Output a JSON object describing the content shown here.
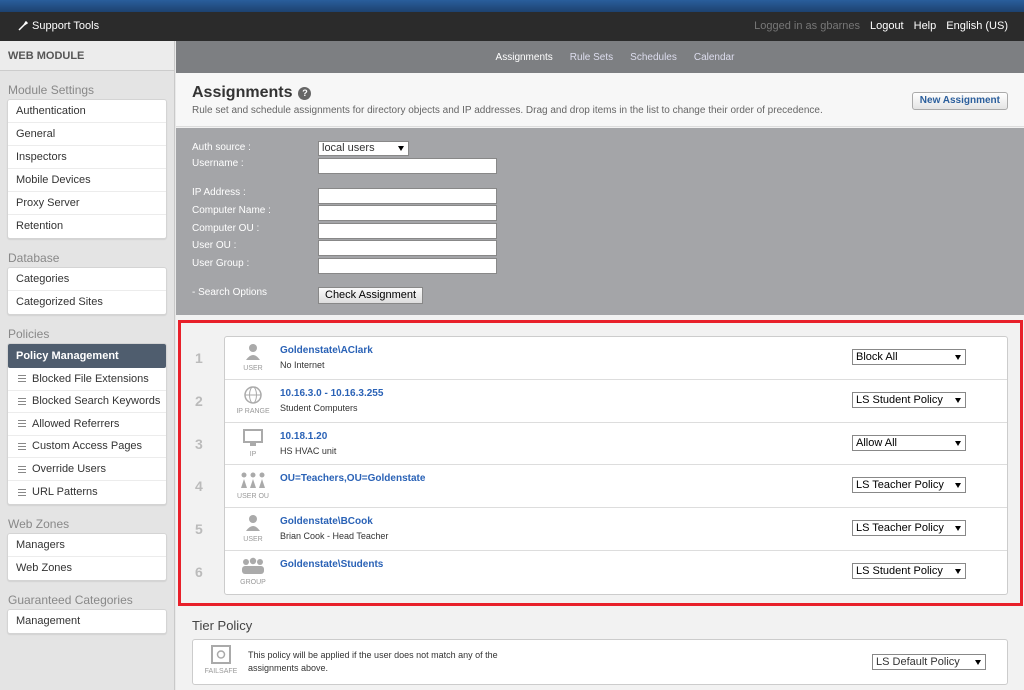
{
  "topbar": {
    "brand": "Support Tools",
    "logged_in": "Logged in as gbarnes",
    "logout": "Logout",
    "help": "Help",
    "language": "English (US)"
  },
  "sidebar": {
    "title": "WEB MODULE",
    "module_settings": {
      "heading": "Module Settings",
      "items": [
        "Authentication",
        "General",
        "Inspectors",
        "Mobile Devices",
        "Proxy Server",
        "Retention"
      ]
    },
    "database": {
      "heading": "Database",
      "items": [
        "Categories",
        "Categorized Sites"
      ]
    },
    "policies": {
      "heading": "Policies",
      "active": "Policy Management",
      "items": [
        "Blocked File Extensions",
        "Blocked Search Keywords",
        "Allowed Referrers",
        "Custom Access Pages",
        "Override Users",
        "URL Patterns"
      ]
    },
    "web_zones": {
      "heading": "Web Zones",
      "items": [
        "Managers",
        "Web Zones"
      ]
    },
    "guaranteed": {
      "heading": "Guaranteed Categories",
      "items": [
        "Management"
      ]
    }
  },
  "tabs": [
    "Assignments",
    "Rule Sets",
    "Schedules",
    "Calendar"
  ],
  "header": {
    "title": "Assignments",
    "help_icon": "?",
    "description": "Rule set and schedule assignments for directory objects and IP addresses. Drag and drop items in the list to change their order of precedence.",
    "new_button": "New Assignment"
  },
  "search": {
    "auth_source_label": "Auth source :",
    "auth_source_value": "local users",
    "username_label": "Username :",
    "ip_label": "IP Address :",
    "computer_name_label": "Computer Name :",
    "computer_ou_label": "Computer OU :",
    "user_ou_label": "User OU :",
    "user_group_label": "User Group :",
    "options_label": "- Search Options",
    "check_button": "Check Assignment"
  },
  "assignments": [
    {
      "num": "1",
      "type": "USER",
      "name": "Goldenstate\\AClark",
      "desc": "No Internet",
      "policy": "Block All"
    },
    {
      "num": "2",
      "type": "IP RANGE",
      "name": "10.16.3.0 - 10.16.3.255",
      "desc": "Student Computers",
      "policy": "LS Student Policy"
    },
    {
      "num": "3",
      "type": "IP",
      "name": "10.18.1.20",
      "desc": "HS HVAC unit",
      "policy": "Allow All"
    },
    {
      "num": "4",
      "type": "USER OU",
      "name": "OU=Teachers,OU=Goldenstate",
      "desc": "",
      "policy": "LS Teacher Policy"
    },
    {
      "num": "5",
      "type": "USER",
      "name": "Goldenstate\\BCook",
      "desc": "Brian Cook - Head Teacher",
      "policy": "LS Teacher Policy"
    },
    {
      "num": "6",
      "type": "GROUP",
      "name": "Goldenstate\\Students",
      "desc": "",
      "policy": "LS Student Policy"
    }
  ],
  "tier": {
    "title": "Tier Policy",
    "icon_label": "FAILSAFE",
    "text": "This policy will be applied if the user does not match any of the assignments above.",
    "policy": "LS Default Policy"
  },
  "colors": {
    "accent": "#2a62b6",
    "highlight_border": "#e8202a",
    "active_nav": "#4f5d6e"
  }
}
